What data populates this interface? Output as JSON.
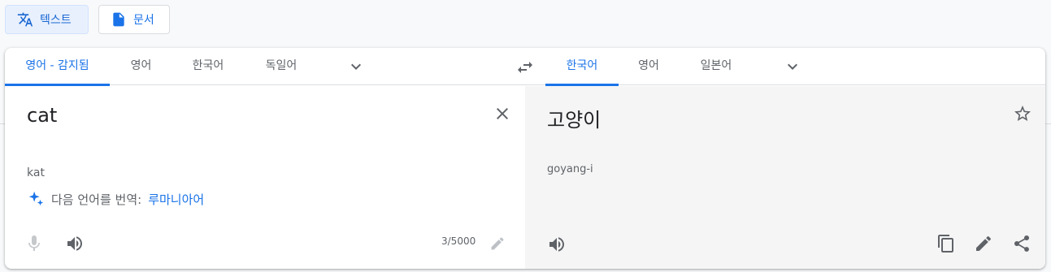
{
  "modes": {
    "text_label": "텍스트",
    "document_label": "문서"
  },
  "source": {
    "languages": [
      "영어 - 감지됨",
      "영어",
      "한국어",
      "독일어"
    ],
    "active_index": 0,
    "text": "cat",
    "transliteration": "kat",
    "suggestion_prefix": "다음 언어를 번역:",
    "suggestion_language": "루마니아어",
    "char_counter": "3/5000"
  },
  "target": {
    "languages": [
      "한국어",
      "영어",
      "일본어"
    ],
    "active_index": 0,
    "text": "고양이",
    "transliteration": "goyang-i"
  },
  "colors": {
    "accent": "#1a73e8",
    "active_tab_bg": "#e8f0fe",
    "target_pane_bg": "#f5f5f5"
  },
  "icons": {
    "text_mode": "translate-icon",
    "document_mode": "document-icon",
    "more_languages": "chevron-down-icon",
    "swap": "swap-icon",
    "clear": "close-icon",
    "sparkle": "sparkle-icon",
    "mic": "mic-icon",
    "listen": "speaker-icon",
    "edit": "pencil-icon",
    "save": "star-icon",
    "copy": "copy-icon",
    "share": "share-icon"
  }
}
